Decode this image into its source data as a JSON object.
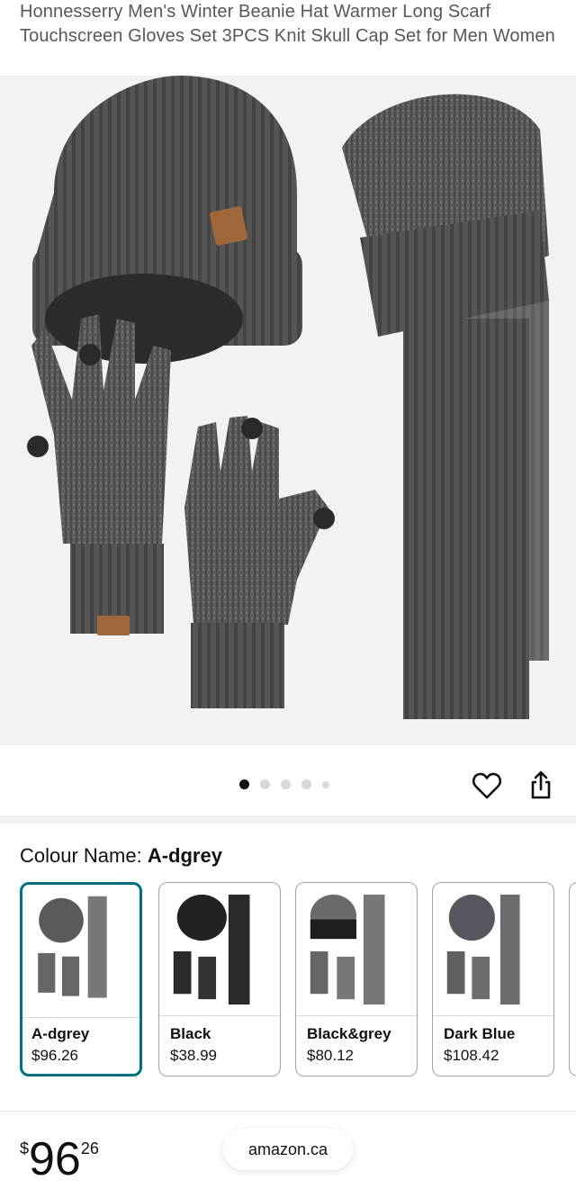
{
  "product": {
    "title": "Honnesserry Men's Winter Beanie Hat Warmer Long Scarf Touchscreen Gloves Set 3PCS Knit Skull Cap Set for Men Women"
  },
  "gallery": {
    "image_count": 5,
    "active_index": 0
  },
  "actions": {
    "favorite_icon": "heart-icon",
    "share_icon": "share-icon"
  },
  "colour": {
    "label": "Colour Name: ",
    "selected": "A-dgrey"
  },
  "swatches": [
    {
      "name": "A-dgrey",
      "price": "$96.26"
    },
    {
      "name": "Black",
      "price": "$38.99"
    },
    {
      "name": "Black&grey",
      "price": "$80.12"
    },
    {
      "name": "Dark Blue",
      "price": "$108.42"
    }
  ],
  "footer": {
    "price_symbol": "$",
    "price_whole": "96",
    "price_fraction": "26",
    "site": "amazon.ca"
  },
  "colors": {
    "selected_border": "#007185",
    "knit_dark_grey": "#5a5a5a"
  }
}
